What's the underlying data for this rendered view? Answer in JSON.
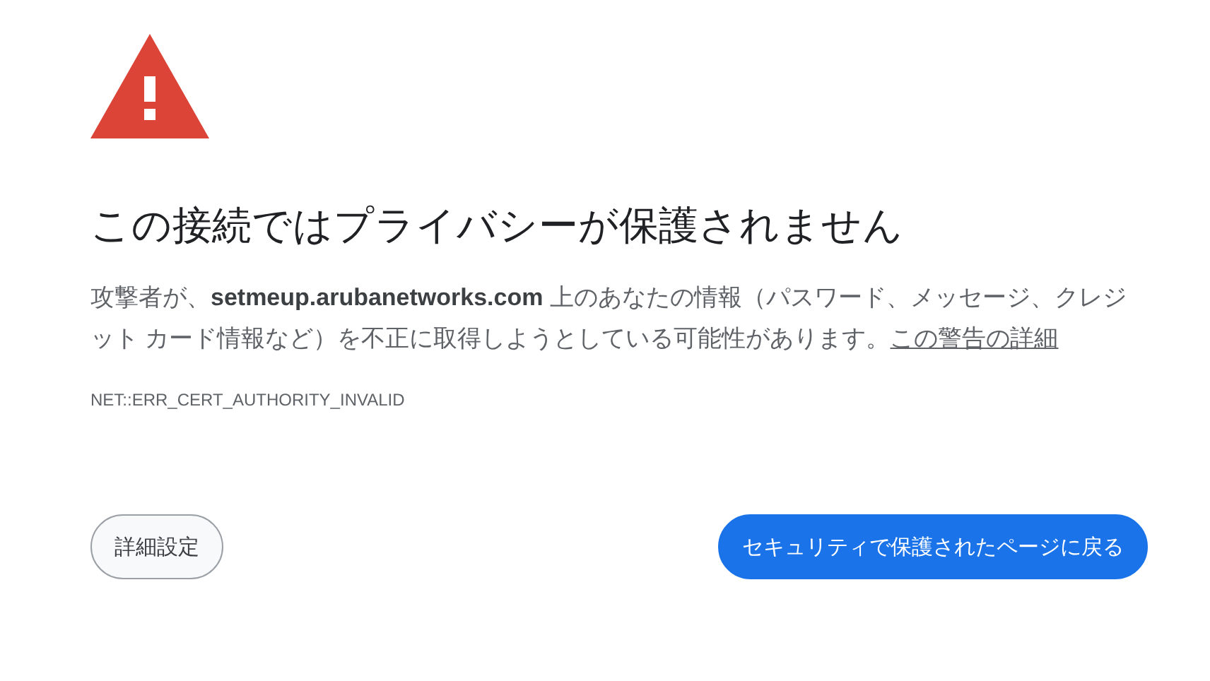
{
  "heading": "この接続ではプライバシーが保護されません",
  "message": {
    "text": "攻撃者が、**setmeup.arubanetworks.com** 上のあなたの情報（パスワード、メッセージ、クレジット カード情報など）を不正に取得しようとしている可能性があります。",
    "link": "この警告の詳細"
  },
  "error_code": "NET::ERR_CERT_AUTHORITY_INVALID",
  "buttons": [
    {
      "label": "詳細設定",
      "kind": "secondary"
    },
    {
      "label": "セキュリティで保護されたページに戻る",
      "kind": "primary"
    }
  ]
}
